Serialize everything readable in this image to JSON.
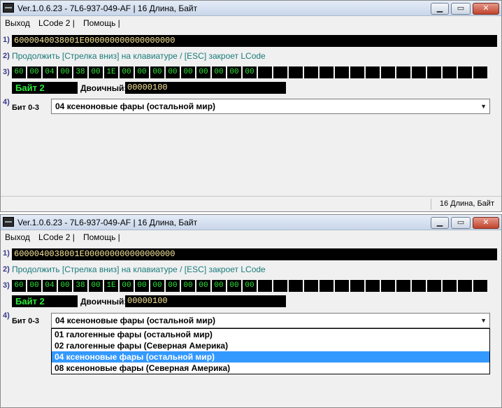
{
  "window": {
    "title": "Ver.1.0.6.23 -  7L6-937-049-AF | 16 Длина, Байт",
    "minimize": "▁",
    "maximize": "▭",
    "close": "✕"
  },
  "menu": {
    "items": [
      "Выход",
      "LCode 2 |",
      "Помощь |"
    ]
  },
  "rows": {
    "n1": "1)",
    "n2": "2)",
    "n3": "3)",
    "n4": "4)"
  },
  "hex_string": "6000040038001E000000000000000000",
  "hint": "Продолжить [Стрелка вниз] на клавиатуре / [ESC] закроет LCode",
  "bytes": [
    "60",
    "00",
    "04",
    "00",
    "38",
    "00",
    "1E",
    "00",
    "00",
    "00",
    "00",
    "00",
    "00",
    "00",
    "00",
    "00",
    "",
    "",
    "",
    "",
    "",
    "",
    "",
    "",
    "",
    "",
    "",
    "",
    "",
    "",
    ""
  ],
  "byte_label": "Байт 2",
  "binary": {
    "label": "Двоичный:",
    "value": "00000100"
  },
  "bit": {
    "label": "Бит 0-3",
    "selected": "04 ксеноновые фары (остальной мир)"
  },
  "options": [
    "01 галогенные фары (остальной мир)",
    "02 галогенные фары (Северная Америка)",
    "04 ксеноновые фары (остальной мир)",
    "08 ксеноновые фары (Северная Америка)"
  ],
  "selected_option_index": 2,
  "status": "16 Длина, Байт",
  "colors": {
    "byte_text": "#2ee83a",
    "hex_text": "#ffeb9c",
    "hint_text": "#1a7a7a",
    "selection": "#3399ff"
  }
}
